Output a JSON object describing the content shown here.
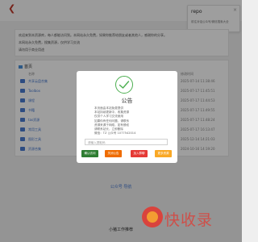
{
  "notice_popup": {
    "title": "repo",
    "text": "前往对话公众号/微信搜索大全",
    "close": "×"
  },
  "intro": {
    "lines": [
      "欢迎来到本资源库，每人都能访问到。本网站永久免费，如果你推荐给朋友或者其他人，感谢你的分享。",
      "本网站永久免费，搜集资源，仅供学习交流",
      "请勿用于商业用途"
    ]
  },
  "files": {
    "home_label": "首页",
    "header_name": "名称",
    "header_date": "修改时间",
    "items": [
      {
        "name": "共享云盘合集",
        "date": "2025-07-14 11:38:46"
      },
      {
        "name": "Toolbox",
        "date": "2025-07-17 11:45:51"
      },
      {
        "name": "课程",
        "date": "2025-07-17 11:44:53"
      },
      {
        "name": "书籍",
        "date": "2025-07-17 11:49:55"
      },
      {
        "name": "tas资源",
        "date": "2025-07-17 11:48:24"
      },
      {
        "name": "常用工具",
        "date": "2025-07-17 16:13:47"
      },
      {
        "name": "图形工具",
        "date": "2025-12-14 14:21:03"
      },
      {
        "name": "资源合集",
        "date": "2024-10-16 14:19:20"
      }
    ]
  },
  "below": {
    "link": "公众号 导航",
    "title": "小猪工作推荐"
  },
  "modal": {
    "title": "公告",
    "body_lines": [
      "本页面由本站免费提供",
      "本站持续更新中，收集资源",
      "仅供个人学习交流使用",
      "如果你有任何问题，请联系",
      "资源来源于网络，如有侵权",
      "请联系站长，立即删除",
      "微信：TZ 公众号 1077542014"
    ],
    "input_placeholder": "请输入提取码"
  },
  "buttons": [
    {
      "label": "确认访问",
      "color": "#2e7d32"
    },
    {
      "label": "关闭公告",
      "color": "#ef6c00"
    },
    {
      "label": "加入群聊",
      "color": "#e53935"
    },
    {
      "label": "更多资源",
      "color": "#f9a825"
    }
  ],
  "watermark": {
    "text": "快收录"
  },
  "colors": {
    "accent_blue": "#4a7bd0",
    "check_green": "#4caf50"
  }
}
